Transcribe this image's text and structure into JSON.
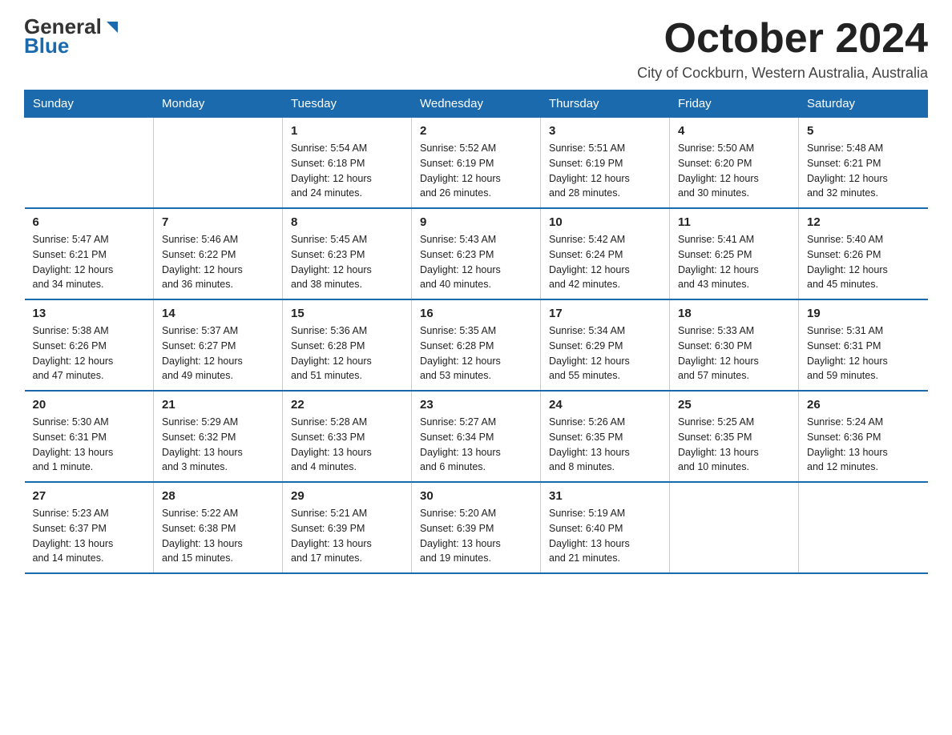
{
  "logo": {
    "general": "General",
    "blue": "Blue",
    "triangle_hint": "▶"
  },
  "title": "October 2024",
  "subtitle": "City of Cockburn, Western Australia, Australia",
  "days_of_week": [
    "Sunday",
    "Monday",
    "Tuesday",
    "Wednesday",
    "Thursday",
    "Friday",
    "Saturday"
  ],
  "weeks": [
    [
      {
        "day": "",
        "info": ""
      },
      {
        "day": "",
        "info": ""
      },
      {
        "day": "1",
        "info": "Sunrise: 5:54 AM\nSunset: 6:18 PM\nDaylight: 12 hours\nand 24 minutes."
      },
      {
        "day": "2",
        "info": "Sunrise: 5:52 AM\nSunset: 6:19 PM\nDaylight: 12 hours\nand 26 minutes."
      },
      {
        "day": "3",
        "info": "Sunrise: 5:51 AM\nSunset: 6:19 PM\nDaylight: 12 hours\nand 28 minutes."
      },
      {
        "day": "4",
        "info": "Sunrise: 5:50 AM\nSunset: 6:20 PM\nDaylight: 12 hours\nand 30 minutes."
      },
      {
        "day": "5",
        "info": "Sunrise: 5:48 AM\nSunset: 6:21 PM\nDaylight: 12 hours\nand 32 minutes."
      }
    ],
    [
      {
        "day": "6",
        "info": "Sunrise: 5:47 AM\nSunset: 6:21 PM\nDaylight: 12 hours\nand 34 minutes."
      },
      {
        "day": "7",
        "info": "Sunrise: 5:46 AM\nSunset: 6:22 PM\nDaylight: 12 hours\nand 36 minutes."
      },
      {
        "day": "8",
        "info": "Sunrise: 5:45 AM\nSunset: 6:23 PM\nDaylight: 12 hours\nand 38 minutes."
      },
      {
        "day": "9",
        "info": "Sunrise: 5:43 AM\nSunset: 6:23 PM\nDaylight: 12 hours\nand 40 minutes."
      },
      {
        "day": "10",
        "info": "Sunrise: 5:42 AM\nSunset: 6:24 PM\nDaylight: 12 hours\nand 42 minutes."
      },
      {
        "day": "11",
        "info": "Sunrise: 5:41 AM\nSunset: 6:25 PM\nDaylight: 12 hours\nand 43 minutes."
      },
      {
        "day": "12",
        "info": "Sunrise: 5:40 AM\nSunset: 6:26 PM\nDaylight: 12 hours\nand 45 minutes."
      }
    ],
    [
      {
        "day": "13",
        "info": "Sunrise: 5:38 AM\nSunset: 6:26 PM\nDaylight: 12 hours\nand 47 minutes."
      },
      {
        "day": "14",
        "info": "Sunrise: 5:37 AM\nSunset: 6:27 PM\nDaylight: 12 hours\nand 49 minutes."
      },
      {
        "day": "15",
        "info": "Sunrise: 5:36 AM\nSunset: 6:28 PM\nDaylight: 12 hours\nand 51 minutes."
      },
      {
        "day": "16",
        "info": "Sunrise: 5:35 AM\nSunset: 6:28 PM\nDaylight: 12 hours\nand 53 minutes."
      },
      {
        "day": "17",
        "info": "Sunrise: 5:34 AM\nSunset: 6:29 PM\nDaylight: 12 hours\nand 55 minutes."
      },
      {
        "day": "18",
        "info": "Sunrise: 5:33 AM\nSunset: 6:30 PM\nDaylight: 12 hours\nand 57 minutes."
      },
      {
        "day": "19",
        "info": "Sunrise: 5:31 AM\nSunset: 6:31 PM\nDaylight: 12 hours\nand 59 minutes."
      }
    ],
    [
      {
        "day": "20",
        "info": "Sunrise: 5:30 AM\nSunset: 6:31 PM\nDaylight: 13 hours\nand 1 minute."
      },
      {
        "day": "21",
        "info": "Sunrise: 5:29 AM\nSunset: 6:32 PM\nDaylight: 13 hours\nand 3 minutes."
      },
      {
        "day": "22",
        "info": "Sunrise: 5:28 AM\nSunset: 6:33 PM\nDaylight: 13 hours\nand 4 minutes."
      },
      {
        "day": "23",
        "info": "Sunrise: 5:27 AM\nSunset: 6:34 PM\nDaylight: 13 hours\nand 6 minutes."
      },
      {
        "day": "24",
        "info": "Sunrise: 5:26 AM\nSunset: 6:35 PM\nDaylight: 13 hours\nand 8 minutes."
      },
      {
        "day": "25",
        "info": "Sunrise: 5:25 AM\nSunset: 6:35 PM\nDaylight: 13 hours\nand 10 minutes."
      },
      {
        "day": "26",
        "info": "Sunrise: 5:24 AM\nSunset: 6:36 PM\nDaylight: 13 hours\nand 12 minutes."
      }
    ],
    [
      {
        "day": "27",
        "info": "Sunrise: 5:23 AM\nSunset: 6:37 PM\nDaylight: 13 hours\nand 14 minutes."
      },
      {
        "day": "28",
        "info": "Sunrise: 5:22 AM\nSunset: 6:38 PM\nDaylight: 13 hours\nand 15 minutes."
      },
      {
        "day": "29",
        "info": "Sunrise: 5:21 AM\nSunset: 6:39 PM\nDaylight: 13 hours\nand 17 minutes."
      },
      {
        "day": "30",
        "info": "Sunrise: 5:20 AM\nSunset: 6:39 PM\nDaylight: 13 hours\nand 19 minutes."
      },
      {
        "day": "31",
        "info": "Sunrise: 5:19 AM\nSunset: 6:40 PM\nDaylight: 13 hours\nand 21 minutes."
      },
      {
        "day": "",
        "info": ""
      },
      {
        "day": "",
        "info": ""
      }
    ]
  ]
}
